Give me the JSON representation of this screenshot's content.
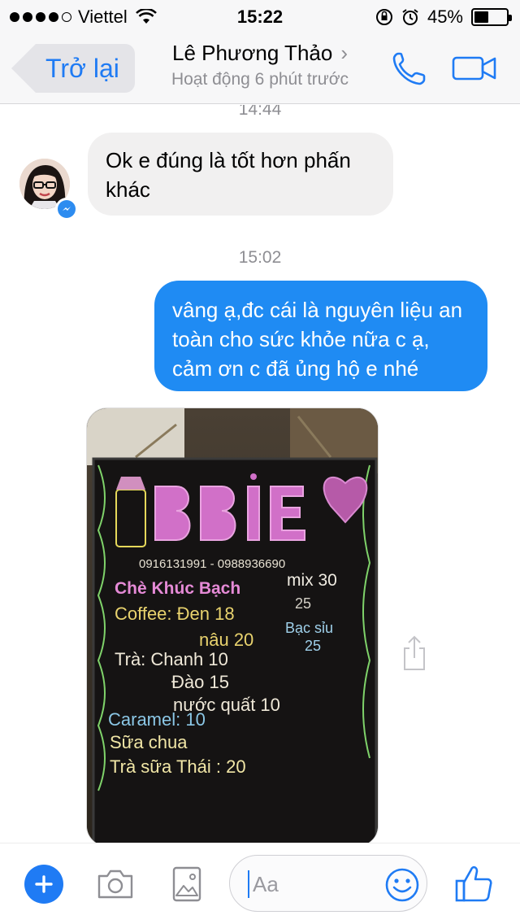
{
  "status_bar": {
    "carrier": "Viettel",
    "time": "15:22",
    "battery_percent": "45%",
    "battery_level": 0.45,
    "signal_bars": 4
  },
  "nav": {
    "back_label": "Trở lại",
    "contact_name": "Lê Phương Thảo",
    "status": "Hoạt động 6 phút trước",
    "accent_color": "#1f7bf4"
  },
  "chat": {
    "timestamps": [
      "14:44",
      "15:02"
    ],
    "incoming_text": "Ok e đúng là tốt hơn phấn khác",
    "outgoing_text": "vâng ạ,đc cái là nguyên liệu an toàn cho sức khỏe nữa c ạ, cảm ơn c đã ủng hộ e nhé",
    "outgoing_color": "#1f8bf3",
    "photo": {
      "brand": "BBIE",
      "phones": "0916131991 - 0988936690",
      "menu": [
        {
          "item": "Chè Khúc Bạch",
          "price": "mix 30"
        },
        {
          "item": "Coffee: Đen",
          "price": "18"
        },
        {
          "item": "nâu",
          "price": "20"
        },
        {
          "item": "Bạc sỉu",
          "price": "25"
        },
        {
          "item": "Trà: Chanh",
          "price": "10"
        },
        {
          "item": "Đào",
          "price": "15"
        },
        {
          "item": "nước quất",
          "price": "10"
        },
        {
          "item": "Caramel",
          "price": "10"
        },
        {
          "item": "Sữa chua",
          "price": ""
        },
        {
          "item": "Trà sữa Thái",
          "price": "20"
        }
      ],
      "extra": "25"
    }
  },
  "composer": {
    "placeholder": "Aa"
  },
  "icons": {
    "back": "chevron-left-icon",
    "call": "phone-icon",
    "video": "video-camera-icon",
    "plus": "plus-icon",
    "camera": "camera-icon",
    "gallery": "image-icon",
    "emoji": "smiley-icon",
    "like": "thumbs-up-icon",
    "share": "share-icon",
    "messenger": "messenger-icon"
  }
}
